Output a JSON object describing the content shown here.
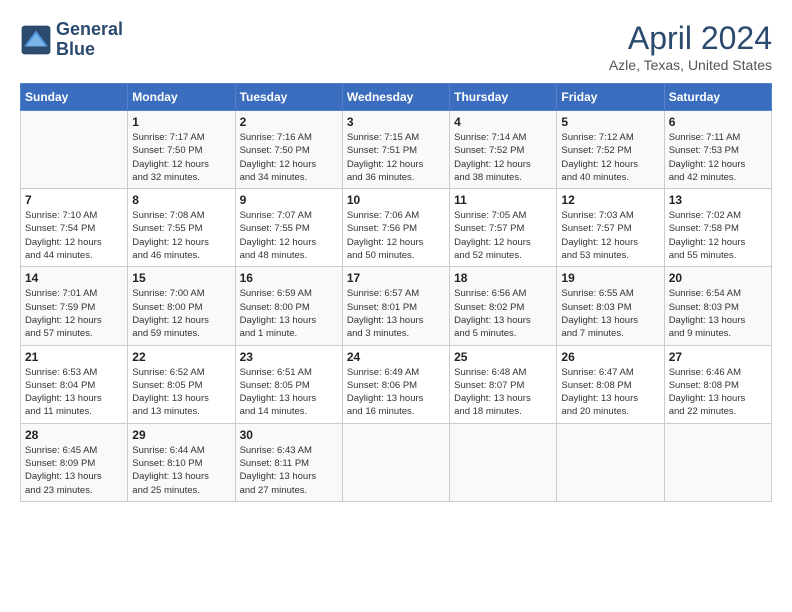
{
  "header": {
    "logo_line1": "General",
    "logo_line2": "Blue",
    "title": "April 2024",
    "subtitle": "Azle, Texas, United States"
  },
  "days_of_week": [
    "Sunday",
    "Monday",
    "Tuesday",
    "Wednesday",
    "Thursday",
    "Friday",
    "Saturday"
  ],
  "weeks": [
    [
      {
        "day": "",
        "info": ""
      },
      {
        "day": "1",
        "info": "Sunrise: 7:17 AM\nSunset: 7:50 PM\nDaylight: 12 hours\nand 32 minutes."
      },
      {
        "day": "2",
        "info": "Sunrise: 7:16 AM\nSunset: 7:50 PM\nDaylight: 12 hours\nand 34 minutes."
      },
      {
        "day": "3",
        "info": "Sunrise: 7:15 AM\nSunset: 7:51 PM\nDaylight: 12 hours\nand 36 minutes."
      },
      {
        "day": "4",
        "info": "Sunrise: 7:14 AM\nSunset: 7:52 PM\nDaylight: 12 hours\nand 38 minutes."
      },
      {
        "day": "5",
        "info": "Sunrise: 7:12 AM\nSunset: 7:52 PM\nDaylight: 12 hours\nand 40 minutes."
      },
      {
        "day": "6",
        "info": "Sunrise: 7:11 AM\nSunset: 7:53 PM\nDaylight: 12 hours\nand 42 minutes."
      }
    ],
    [
      {
        "day": "7",
        "info": "Sunrise: 7:10 AM\nSunset: 7:54 PM\nDaylight: 12 hours\nand 44 minutes."
      },
      {
        "day": "8",
        "info": "Sunrise: 7:08 AM\nSunset: 7:55 PM\nDaylight: 12 hours\nand 46 minutes."
      },
      {
        "day": "9",
        "info": "Sunrise: 7:07 AM\nSunset: 7:55 PM\nDaylight: 12 hours\nand 48 minutes."
      },
      {
        "day": "10",
        "info": "Sunrise: 7:06 AM\nSunset: 7:56 PM\nDaylight: 12 hours\nand 50 minutes."
      },
      {
        "day": "11",
        "info": "Sunrise: 7:05 AM\nSunset: 7:57 PM\nDaylight: 12 hours\nand 52 minutes."
      },
      {
        "day": "12",
        "info": "Sunrise: 7:03 AM\nSunset: 7:57 PM\nDaylight: 12 hours\nand 53 minutes."
      },
      {
        "day": "13",
        "info": "Sunrise: 7:02 AM\nSunset: 7:58 PM\nDaylight: 12 hours\nand 55 minutes."
      }
    ],
    [
      {
        "day": "14",
        "info": "Sunrise: 7:01 AM\nSunset: 7:59 PM\nDaylight: 12 hours\nand 57 minutes."
      },
      {
        "day": "15",
        "info": "Sunrise: 7:00 AM\nSunset: 8:00 PM\nDaylight: 12 hours\nand 59 minutes."
      },
      {
        "day": "16",
        "info": "Sunrise: 6:59 AM\nSunset: 8:00 PM\nDaylight: 13 hours\nand 1 minute."
      },
      {
        "day": "17",
        "info": "Sunrise: 6:57 AM\nSunset: 8:01 PM\nDaylight: 13 hours\nand 3 minutes."
      },
      {
        "day": "18",
        "info": "Sunrise: 6:56 AM\nSunset: 8:02 PM\nDaylight: 13 hours\nand 5 minutes."
      },
      {
        "day": "19",
        "info": "Sunrise: 6:55 AM\nSunset: 8:03 PM\nDaylight: 13 hours\nand 7 minutes."
      },
      {
        "day": "20",
        "info": "Sunrise: 6:54 AM\nSunset: 8:03 PM\nDaylight: 13 hours\nand 9 minutes."
      }
    ],
    [
      {
        "day": "21",
        "info": "Sunrise: 6:53 AM\nSunset: 8:04 PM\nDaylight: 13 hours\nand 11 minutes."
      },
      {
        "day": "22",
        "info": "Sunrise: 6:52 AM\nSunset: 8:05 PM\nDaylight: 13 hours\nand 13 minutes."
      },
      {
        "day": "23",
        "info": "Sunrise: 6:51 AM\nSunset: 8:05 PM\nDaylight: 13 hours\nand 14 minutes."
      },
      {
        "day": "24",
        "info": "Sunrise: 6:49 AM\nSunset: 8:06 PM\nDaylight: 13 hours\nand 16 minutes."
      },
      {
        "day": "25",
        "info": "Sunrise: 6:48 AM\nSunset: 8:07 PM\nDaylight: 13 hours\nand 18 minutes."
      },
      {
        "day": "26",
        "info": "Sunrise: 6:47 AM\nSunset: 8:08 PM\nDaylight: 13 hours\nand 20 minutes."
      },
      {
        "day": "27",
        "info": "Sunrise: 6:46 AM\nSunset: 8:08 PM\nDaylight: 13 hours\nand 22 minutes."
      }
    ],
    [
      {
        "day": "28",
        "info": "Sunrise: 6:45 AM\nSunset: 8:09 PM\nDaylight: 13 hours\nand 23 minutes."
      },
      {
        "day": "29",
        "info": "Sunrise: 6:44 AM\nSunset: 8:10 PM\nDaylight: 13 hours\nand 25 minutes."
      },
      {
        "day": "30",
        "info": "Sunrise: 6:43 AM\nSunset: 8:11 PM\nDaylight: 13 hours\nand 27 minutes."
      },
      {
        "day": "",
        "info": ""
      },
      {
        "day": "",
        "info": ""
      },
      {
        "day": "",
        "info": ""
      },
      {
        "day": "",
        "info": ""
      }
    ]
  ]
}
